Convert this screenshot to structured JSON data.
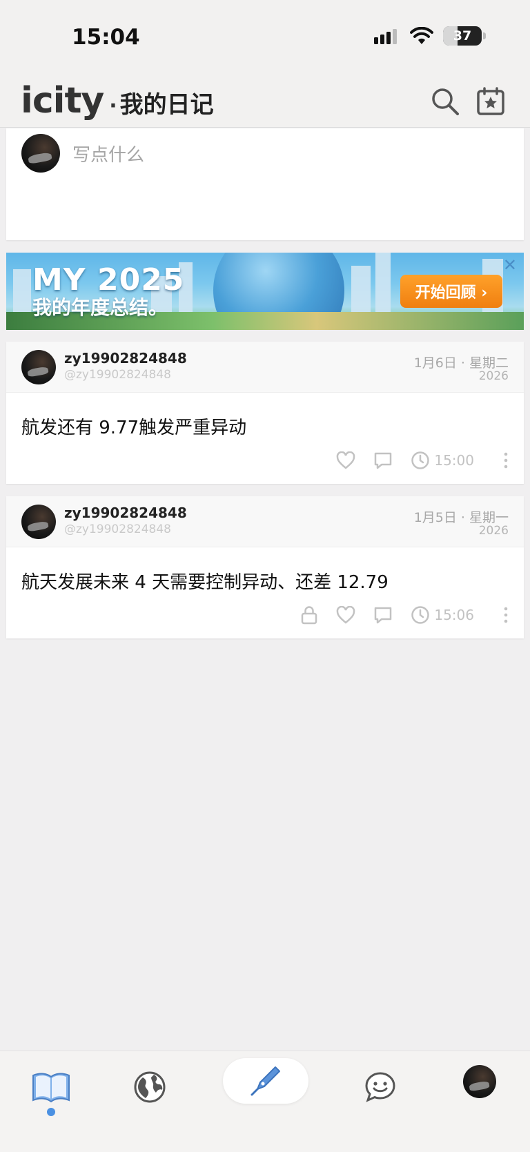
{
  "status_bar": {
    "time": "15:04",
    "battery": "37",
    "battery_level": 0.37
  },
  "header": {
    "logo": "icity",
    "separator": "·",
    "title": "我的日记",
    "search_icon": "search-icon",
    "calendar_icon": "calendar-star-icon"
  },
  "composer": {
    "placeholder": "写点什么"
  },
  "banner": {
    "headline": "MY 2025",
    "subtitle": "我的年度总结。",
    "button_label": "开始回顾 ›",
    "close_label": "✕"
  },
  "posts": [
    {
      "username": "zy19902824848",
      "handle": "@zy19902824848",
      "date": "1月6日 · 星期二",
      "year": "2026",
      "text": "航发还有 9.77触发严重异动",
      "time": "15:00",
      "locked": false
    },
    {
      "username": "zy19902824848",
      "handle": "@zy19902824848",
      "date": "1月5日 · 星期一",
      "year": "2026",
      "text": "航天发展未来 4 天需要控制异动、还差 12.79",
      "time": "15:06",
      "locked": true
    }
  ],
  "tabbar": {
    "tabs": [
      "book-icon",
      "globe-icon",
      "pen-icon",
      "chat-icon",
      "profile-avatar"
    ],
    "active": 0,
    "accent": "#4a90e2"
  }
}
